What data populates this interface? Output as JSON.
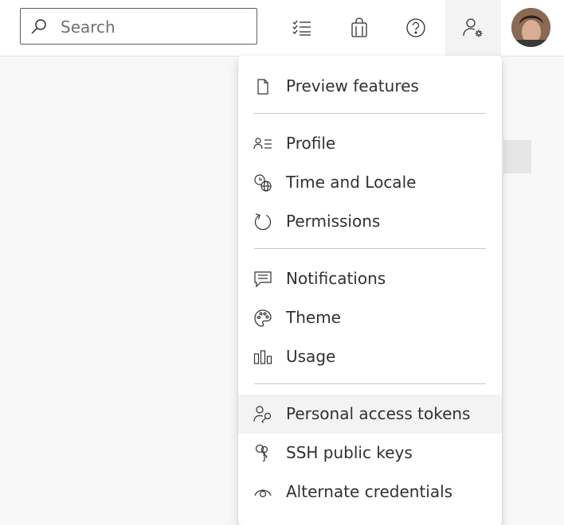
{
  "search": {
    "placeholder": "Search",
    "value": ""
  },
  "toolbar": {
    "icons": [
      "task-list-icon",
      "marketplace-bag-icon",
      "help-icon",
      "user-settings-icon"
    ]
  },
  "menu": {
    "sections": [
      {
        "items": [
          {
            "label": "Preview features",
            "icon": "page-icon"
          }
        ]
      },
      {
        "items": [
          {
            "label": "Profile",
            "icon": "profile-icon"
          },
          {
            "label": "Time and Locale",
            "icon": "globe-clock-icon"
          },
          {
            "label": "Permissions",
            "icon": "refresh-icon"
          }
        ]
      },
      {
        "items": [
          {
            "label": "Notifications",
            "icon": "message-icon"
          },
          {
            "label": "Theme",
            "icon": "palette-icon"
          },
          {
            "label": "Usage",
            "icon": "bar-chart-icon"
          }
        ]
      },
      {
        "items": [
          {
            "label": "Personal access tokens",
            "icon": "user-key-icon"
          },
          {
            "label": "SSH public keys",
            "icon": "keys-icon"
          },
          {
            "label": "Alternate credentials",
            "icon": "eye-icon"
          }
        ]
      }
    ],
    "hovered_item": "Personal access tokens"
  },
  "colors": {
    "text": "#323130",
    "border": "#c8c8c8",
    "hover": "#f3f3f3"
  }
}
